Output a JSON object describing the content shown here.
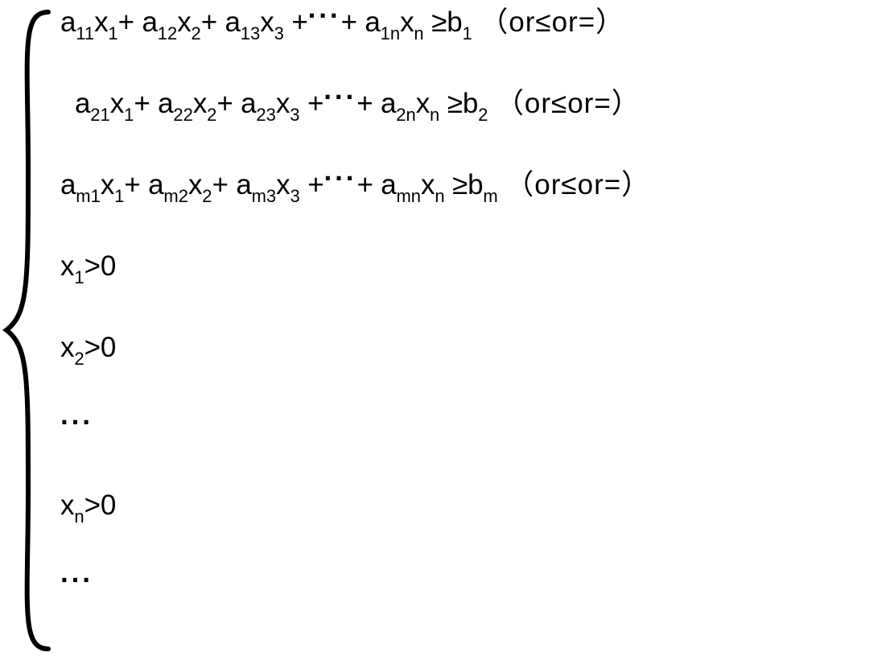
{
  "equations": {
    "row1": {
      "terms": [
        {
          "a_sub": "11",
          "x_sub": "1"
        },
        {
          "a_sub": "12",
          "x_sub": "2"
        },
        {
          "a_sub": "13",
          "x_sub": "3"
        }
      ],
      "last": {
        "a_sub": "1n",
        "x_sub": "n"
      },
      "rel": "≥",
      "b_sub": "1",
      "suffix": "（or≤or=）"
    },
    "row2": {
      "terms": [
        {
          "a_sub": "21",
          "x_sub": "1"
        },
        {
          "a_sub": "22",
          "x_sub": "2"
        },
        {
          "a_sub": "23",
          "x_sub": "3"
        }
      ],
      "last": {
        "a_sub": "2n",
        "x_sub": "n"
      },
      "rel": "≥",
      "b_sub": "2",
      "suffix": "（or≤or=）"
    },
    "row3": {
      "terms": [
        {
          "a_sub": "m1",
          "x_sub": "1"
        },
        {
          "a_sub": "m2",
          "x_sub": "2"
        },
        {
          "a_sub": "m3",
          "x_sub": "3"
        }
      ],
      "last": {
        "a_sub": "mn",
        "x_sub": "n"
      },
      "rel": "≥",
      "b_sub": "m",
      "suffix": "（or≤or=）"
    },
    "pos1": {
      "x_sub": "1",
      "rel": ">",
      "rhs": "0"
    },
    "pos2": {
      "x_sub": "2",
      "rel": ">",
      "rhs": "0"
    },
    "posn": {
      "x_sub": "n",
      "rel": ">",
      "rhs": "0"
    },
    "hdots": "···",
    "ldots": "···",
    "ldots2": "···",
    "plus": "+ ",
    "a": "a",
    "x": "x",
    "b": "b"
  }
}
